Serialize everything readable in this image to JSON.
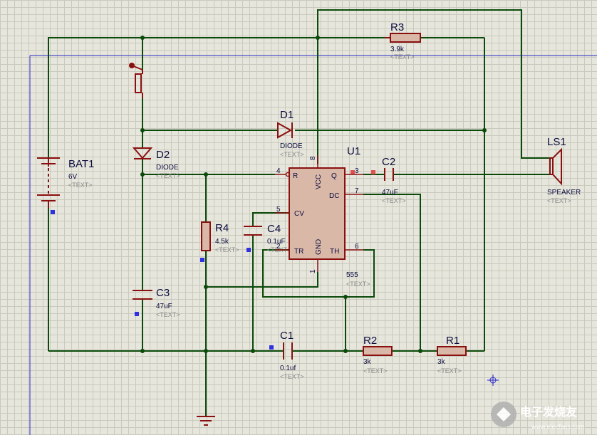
{
  "components": {
    "bat1": {
      "ref": "BAT1",
      "value": "6V",
      "text": "<TEXT>"
    },
    "d1": {
      "ref": "D1",
      "value": "DIODE",
      "text": "<TEXT>"
    },
    "d2": {
      "ref": "D2",
      "value": "DIODE",
      "text": "<TEXT>"
    },
    "r3": {
      "ref": "R3",
      "value": "3.9k",
      "text": "<TEXT>"
    },
    "r4": {
      "ref": "R4",
      "value": "4.5k",
      "text": "<TEXT>"
    },
    "r2": {
      "ref": "R2",
      "value": "3k",
      "text": "<TEXT>"
    },
    "r1": {
      "ref": "R1",
      "value": "3k",
      "text": "<TEXT>"
    },
    "c1": {
      "ref": "C1",
      "value": "0.1uf",
      "text": "<TEXT>"
    },
    "c2": {
      "ref": "C2",
      "value": "47uF",
      "text": "<TEXT>"
    },
    "c3": {
      "ref": "C3",
      "value": "47uF",
      "text": "<TEXT>"
    },
    "c4": {
      "ref": "C4",
      "value": "0.1uF",
      "text": "<TEXT>"
    },
    "ls1": {
      "ref": "LS1",
      "value": "SPEAKER",
      "text": "<TEXT>"
    },
    "u1": {
      "ref": "U1",
      "value": "555",
      "text": "<TEXT>",
      "pins": {
        "r": "R",
        "vcc": "VCC",
        "q": "Q",
        "dc": "DC",
        "cv": "CV",
        "tr": "TR",
        "gnd": "GND",
        "th": "TH",
        "n1": "1",
        "n2": "2",
        "n3": "3",
        "n4": "4",
        "n5": "5",
        "n6": "6",
        "n7": "7",
        "n8": "8"
      }
    }
  },
  "watermark": {
    "text": "电子发烧友",
    "url": "www.elecfans.com"
  },
  "colors": {
    "wire": "#0a4a0a",
    "component": "#8a1010",
    "grid": "#c9c9bd",
    "background": "#e6e6dc",
    "label": "#0c0c40"
  }
}
